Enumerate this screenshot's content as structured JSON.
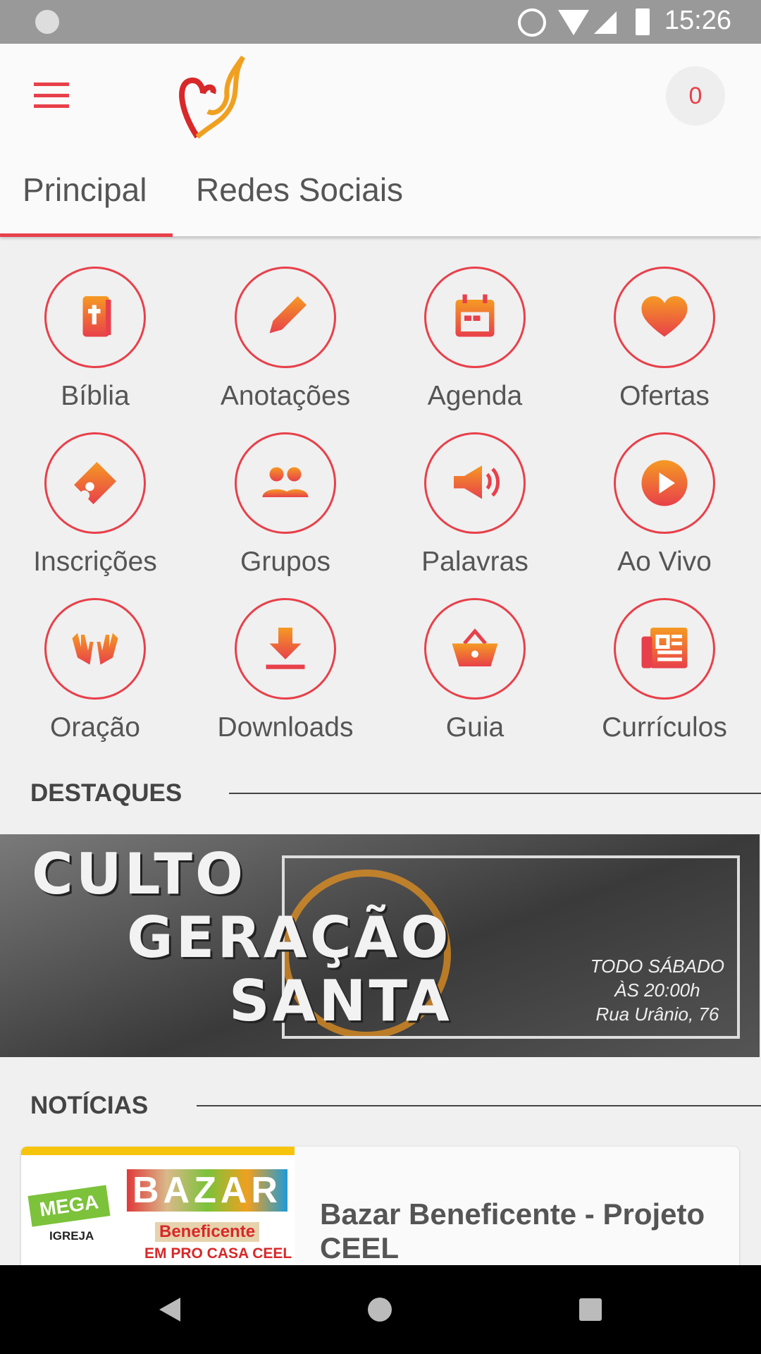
{
  "status_bar": {
    "time": "15:26"
  },
  "header": {
    "cart_count": "0",
    "logo": "Cristianismo Decidido"
  },
  "tabs": [
    {
      "label": "Principal",
      "active": true
    },
    {
      "label": "Redes Sociais",
      "active": false
    }
  ],
  "grid": [
    {
      "label": "Bíblia",
      "icon": "bible-icon"
    },
    {
      "label": "Anotações",
      "icon": "pencil-icon"
    },
    {
      "label": "Agenda",
      "icon": "calendar-icon"
    },
    {
      "label": "Ofertas",
      "icon": "heart-icon"
    },
    {
      "label": "Inscrições",
      "icon": "ticket-icon"
    },
    {
      "label": "Grupos",
      "icon": "group-icon"
    },
    {
      "label": "Palavras",
      "icon": "megaphone-icon"
    },
    {
      "label": "Ao Vivo",
      "icon": "play-icon"
    },
    {
      "label": "Oração",
      "icon": "hands-icon"
    },
    {
      "label": "Downloads",
      "icon": "download-icon"
    },
    {
      "label": "Guia",
      "icon": "basket-icon"
    },
    {
      "label": "Currículos",
      "icon": "newspaper-icon"
    }
  ],
  "highlights": {
    "title": "DESTAQUES",
    "banner": {
      "line1": "CULTO",
      "line2": "GERAÇÃO",
      "line3": "SANTA",
      "schedule": [
        "TODO SÁBADO",
        "ÀS 20:00h",
        "Rua Urânio, 76"
      ]
    }
  },
  "news": {
    "title": "NOTÍCIAS",
    "items": [
      {
        "title": "Bazar Beneficente - Projeto CEEL",
        "image_text": [
          "MEGA",
          "BAZAR",
          "Beneficente",
          "EM PRO CASA CEEL",
          "IGREJA"
        ]
      }
    ]
  },
  "colors": {
    "accent": "#e8404a",
    "gradient_start": "#f59a23",
    "gradient_end": "#e8404a"
  }
}
